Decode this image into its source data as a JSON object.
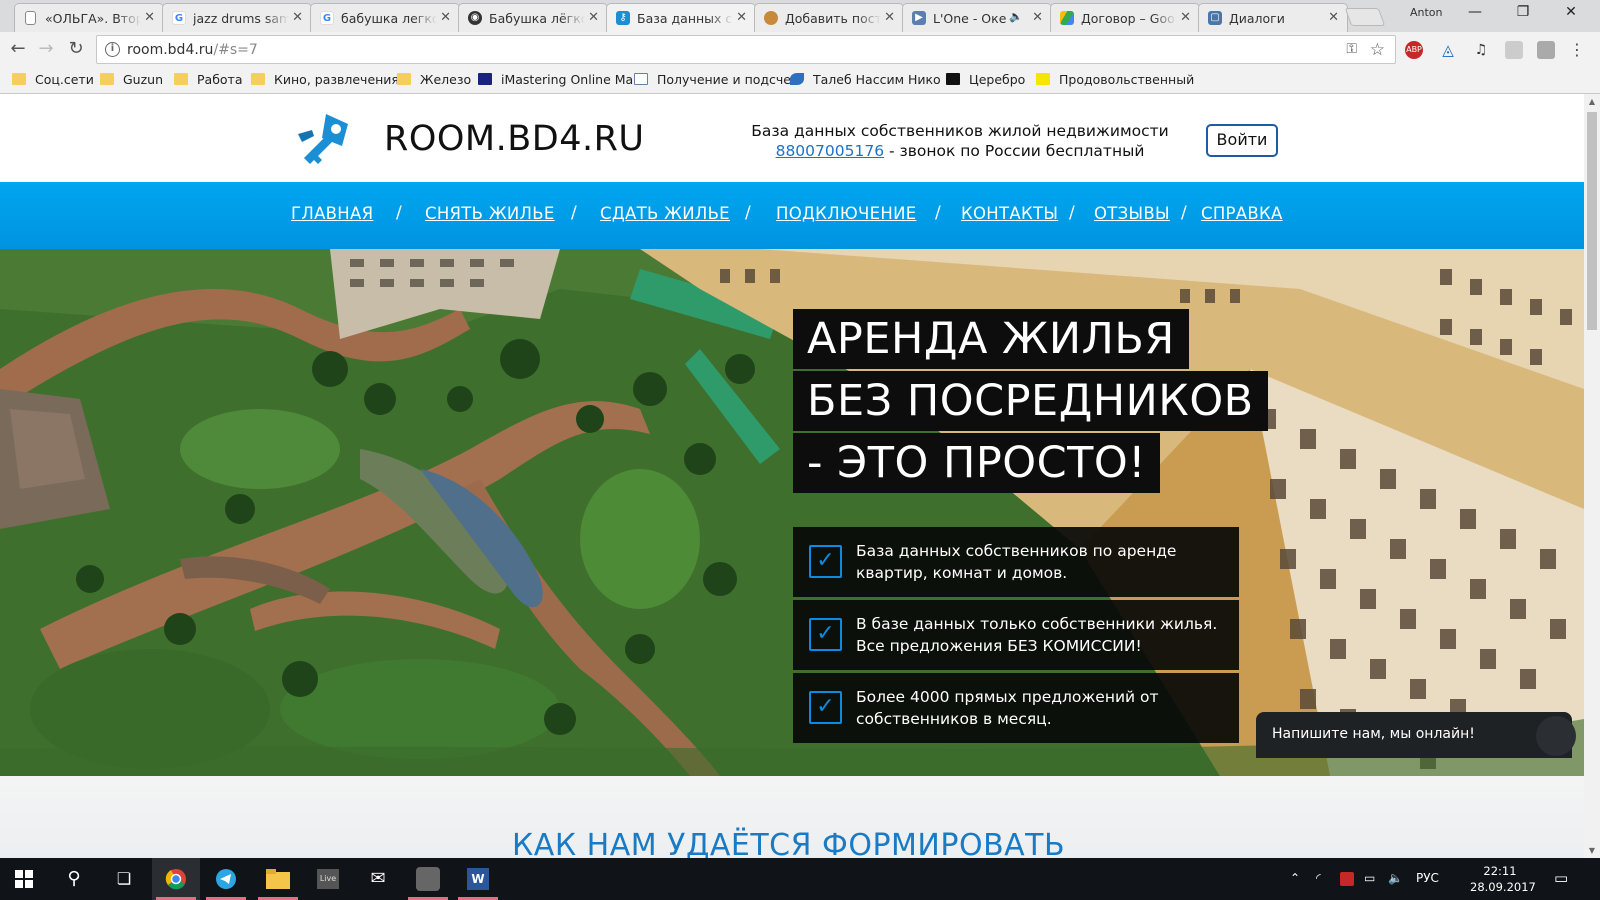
{
  "tabs": [
    {
      "title": "«ОЛЬГА». Втор",
      "favicon": "document-icon",
      "active": false
    },
    {
      "title": "jazz drums sam",
      "favicon": "google-icon",
      "active": false
    },
    {
      "title": "бабушка легко",
      "favicon": "google-icon",
      "active": false
    },
    {
      "title": "Бабушка лёгко",
      "favicon": "panda-icon",
      "active": false
    },
    {
      "title": "База данных со",
      "favicon": "key-icon",
      "active": true
    },
    {
      "title": "Добавить пост",
      "favicon": "cookie-icon",
      "active": false
    },
    {
      "title": "L'One - Оке",
      "favicon": "video-icon",
      "active": false
    },
    {
      "title": "Договор – Goo",
      "favicon": "drive-icon",
      "active": false
    },
    {
      "title": "Диалоги",
      "favicon": "chat-icon",
      "active": false
    }
  ],
  "window": {
    "profile": "Anton"
  },
  "address_bar": {
    "url_host": "room.bd4.ru",
    "url_rest": "/#s=7"
  },
  "bookmarks": [
    {
      "label": "Соц.сети",
      "icon": "folder-icon"
    },
    {
      "label": "Guzun",
      "icon": "folder-icon"
    },
    {
      "label": "Работа",
      "icon": "folder-icon"
    },
    {
      "label": "Кино, развлечения",
      "icon": "folder-icon"
    },
    {
      "label": "Железо",
      "icon": "folder-icon"
    },
    {
      "label": "iMastering Online Ma",
      "icon": "imastering-icon"
    },
    {
      "label": "Получение и подсче",
      "icon": "page-icon"
    },
    {
      "label": "Талеб Нассим Нико",
      "icon": "bird-icon"
    },
    {
      "label": "Церебро",
      "icon": "cerebro-icon"
    },
    {
      "label": "Продовольственный",
      "icon": "yellow-square-icon"
    }
  ],
  "site": {
    "brand": "ROOM.BD4.RU",
    "tagline_line1": "База данных собственников жилой недвижимости",
    "phone": "88007005176",
    "tagline_line2_rest": " - звонок по России бесплатный",
    "login_label": "Войти",
    "nav": [
      "ГЛАВНАЯ",
      "СНЯТЬ ЖИЛЬЕ",
      "СДАТЬ ЖИЛЬЕ",
      "ПОДКЛЮЧЕНИЕ",
      "КОНТАКТЫ",
      "ОТЗЫВЫ",
      "СПРАВКА"
    ],
    "nav_separator": "/",
    "headline": [
      "АРЕНДА ЖИЛЬЯ",
      "БЕЗ ПОСРЕДНИКОВ",
      "- ЭТО ПРОСТО!"
    ],
    "features": [
      {
        "line1": "База данных собственников по аренде",
        "line2": "квартир, комнат и домов."
      },
      {
        "line1": "В базе данных только собственники жилья.",
        "line2": "Все предложения БЕЗ КОМИССИИ!"
      },
      {
        "line1": "Более 4000 прямых предложений от",
        "line2": "собственников в месяц."
      }
    ],
    "section_title": "КАК НАМ УДАЁТСЯ ФОРМИРОВАТЬ",
    "chat_label": "Напишите нам, мы онлайн!"
  },
  "taskbar": {
    "language": "РУС",
    "time": "22:11",
    "date": "28.09.2017",
    "apps": [
      "start-icon",
      "search-icon",
      "task-view-icon",
      "chrome-icon",
      "telegram-icon",
      "explorer-icon",
      "live-icon",
      "mail-icon",
      "camera-app-icon",
      "word-icon"
    ]
  },
  "colors": {
    "nav_blue": "#0096e3",
    "check_blue": "#0d8be0",
    "title_blue": "#1a7bc4"
  }
}
